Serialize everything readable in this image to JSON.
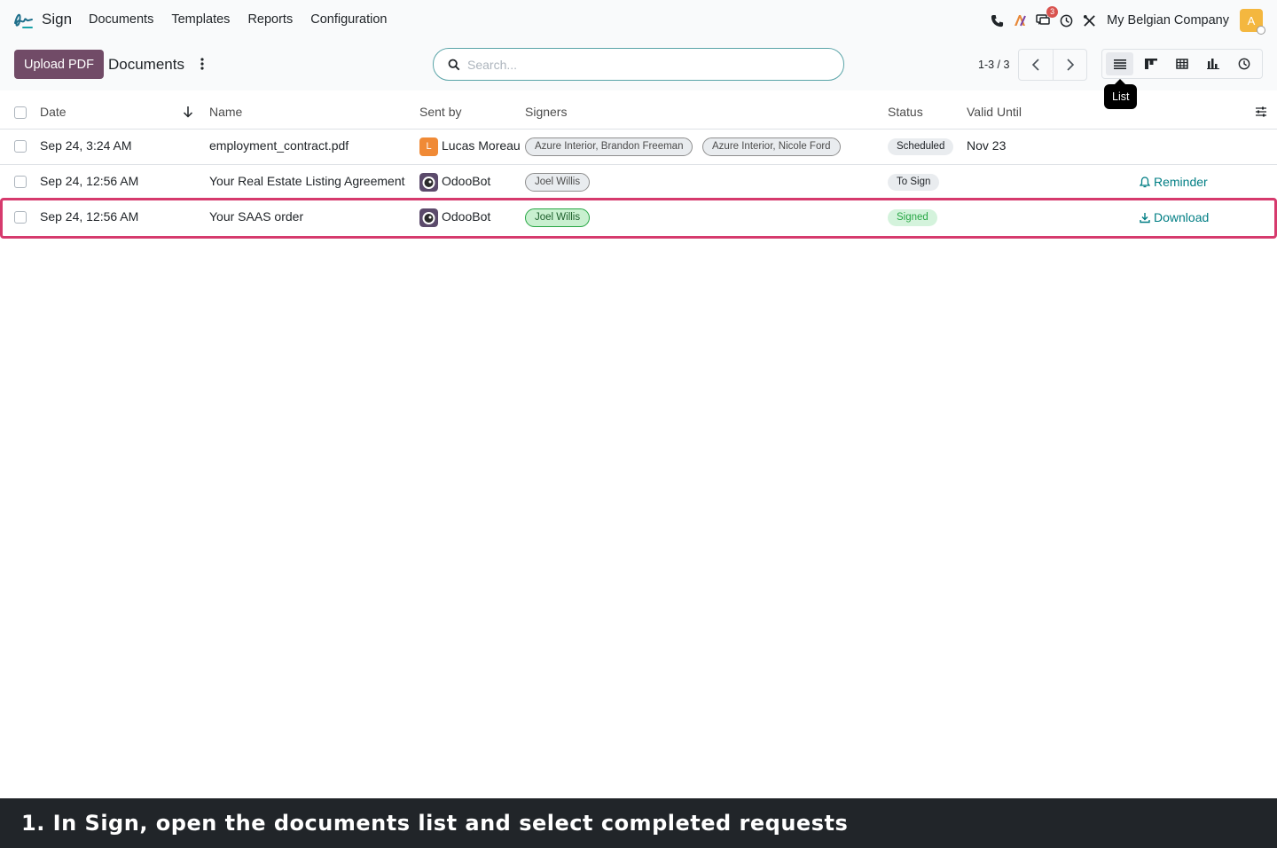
{
  "app": {
    "name": "Sign"
  },
  "menu": [
    "Documents",
    "Templates",
    "Reports",
    "Configuration"
  ],
  "systray": {
    "messages_count": "3",
    "company": "My Belgian Company",
    "user_initial": "A"
  },
  "control_panel": {
    "upload_label": "Upload PDF",
    "breadcrumb": "Documents",
    "search_placeholder": "Search...",
    "pager": "1-3 / 3",
    "tooltip": "List"
  },
  "columns": {
    "date": "Date",
    "name": "Name",
    "sent_by": "Sent by",
    "signers": "Signers",
    "status": "Status",
    "valid_until": "Valid Until"
  },
  "rows": [
    {
      "date": "Sep 24, 3:24 AM",
      "name": "employment_contract.pdf",
      "sender": "Lucas Moreau",
      "sender_initial": "L",
      "signers": [
        "Azure Interior, Brandon Freeman",
        "Azure Interior, Nicole Ford"
      ],
      "status": "Scheduled",
      "valid_until": "Nov 23",
      "action": ""
    },
    {
      "date": "Sep 24, 12:56 AM",
      "name": "Your Real Estate Listing Agreement",
      "sender": "OdooBot",
      "signers": [
        "Joel Willis"
      ],
      "status": "To Sign",
      "valid_until": "",
      "action": "Reminder"
    },
    {
      "date": "Sep 24, 12:56 AM",
      "name": "Your SAAS order",
      "sender": "OdooBot",
      "signers": [
        "Joel Willis"
      ],
      "status": "Signed",
      "valid_until": "",
      "action": "Download"
    }
  ],
  "caption": "1. In Sign, open the documents list and select completed requests"
}
